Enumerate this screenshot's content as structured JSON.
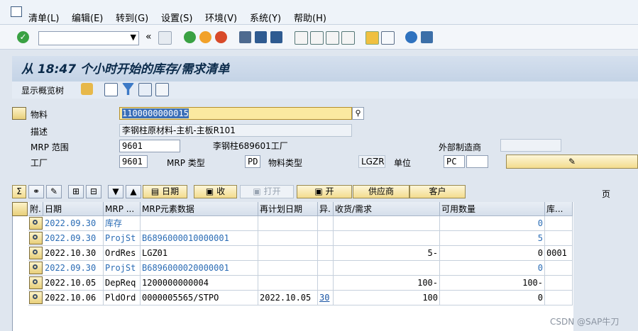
{
  "menu": {
    "items": [
      "清单(L)",
      "编辑(E)",
      "转到(G)",
      "设置(S)",
      "环境(V)",
      "系统(Y)",
      "帮助(H)"
    ]
  },
  "toolbar": {
    "command_value": "",
    "back_chevron": "«"
  },
  "title": "从 18:47 个小时开始的库存/需求清单",
  "apptool": {
    "overview_label": "显示概览树"
  },
  "header": {
    "material_label": "物料",
    "material_value": "1100000000015",
    "desc_label": "描述",
    "desc_value": "李钢柱原材料-主机-主板R101",
    "mrp_area_label": "MRP 范围",
    "mrp_area_value": "9601",
    "mrp_area_text": "李钢柱689601工厂",
    "ext_mfr_label": "外部制造商",
    "ext_mfr_value": "",
    "plant_label": "工厂",
    "plant_value": "9601",
    "mrp_type_label": "MRP 类型",
    "mrp_type_value": "PD",
    "mat_type_label": "物料类型",
    "mat_type_value": "LGZR",
    "unit_label": "单位",
    "unit_value": "PC",
    "unit_extra": ""
  },
  "buttons": {
    "date": "日期",
    "receipt": "收",
    "open": "打开",
    "open2": "开",
    "vendor": "供应商",
    "customer": "客户",
    "page": "页"
  },
  "table": {
    "columns": [
      "附.",
      "日期",
      "MRP ...",
      "MRP元素数据",
      "再计划日期",
      "异.",
      "收货/需求",
      "可用数量",
      "库..."
    ],
    "rows": [
      {
        "date": "2022.09.30",
        "mrp": "库存",
        "data": "",
        "resched": "",
        "exc": "",
        "qty": "",
        "avail": "0",
        "stor": "",
        "blue": true
      },
      {
        "date": "2022.09.30",
        "mrp": "ProjSt",
        "data": "B6896000010000001",
        "resched": "",
        "exc": "",
        "qty": "",
        "avail": "5",
        "stor": "",
        "blue": true
      },
      {
        "date": "2022.10.30",
        "mrp": "OrdRes",
        "data": "LGZ01",
        "resched": "",
        "exc": "",
        "qty": "5-",
        "avail": "0",
        "stor": "0001",
        "blue": false
      },
      {
        "date": "2022.09.30",
        "mrp": "ProjSt",
        "data": "B6896000020000001",
        "resched": "",
        "exc": "",
        "qty": "",
        "avail": "0",
        "stor": "",
        "blue": true
      },
      {
        "date": "2022.10.05",
        "mrp": "DepReq",
        "data": "1200000000004",
        "resched": "",
        "exc": "",
        "qty": "100-",
        "avail": "100-",
        "stor": "",
        "blue": false
      },
      {
        "date": "2022.10.06",
        "mrp": "PldOrd",
        "data": "0000005565/STPO",
        "resched": "2022.10.05",
        "exc": "30",
        "qty": "100",
        "avail": "0",
        "stor": "",
        "blue": false
      }
    ]
  },
  "watermark": "CSDN @SAP牛刀",
  "colors": {
    "accent": "#2a6cb5",
    "title": "#0a2a4a",
    "highlight": "#fbe9a0"
  }
}
